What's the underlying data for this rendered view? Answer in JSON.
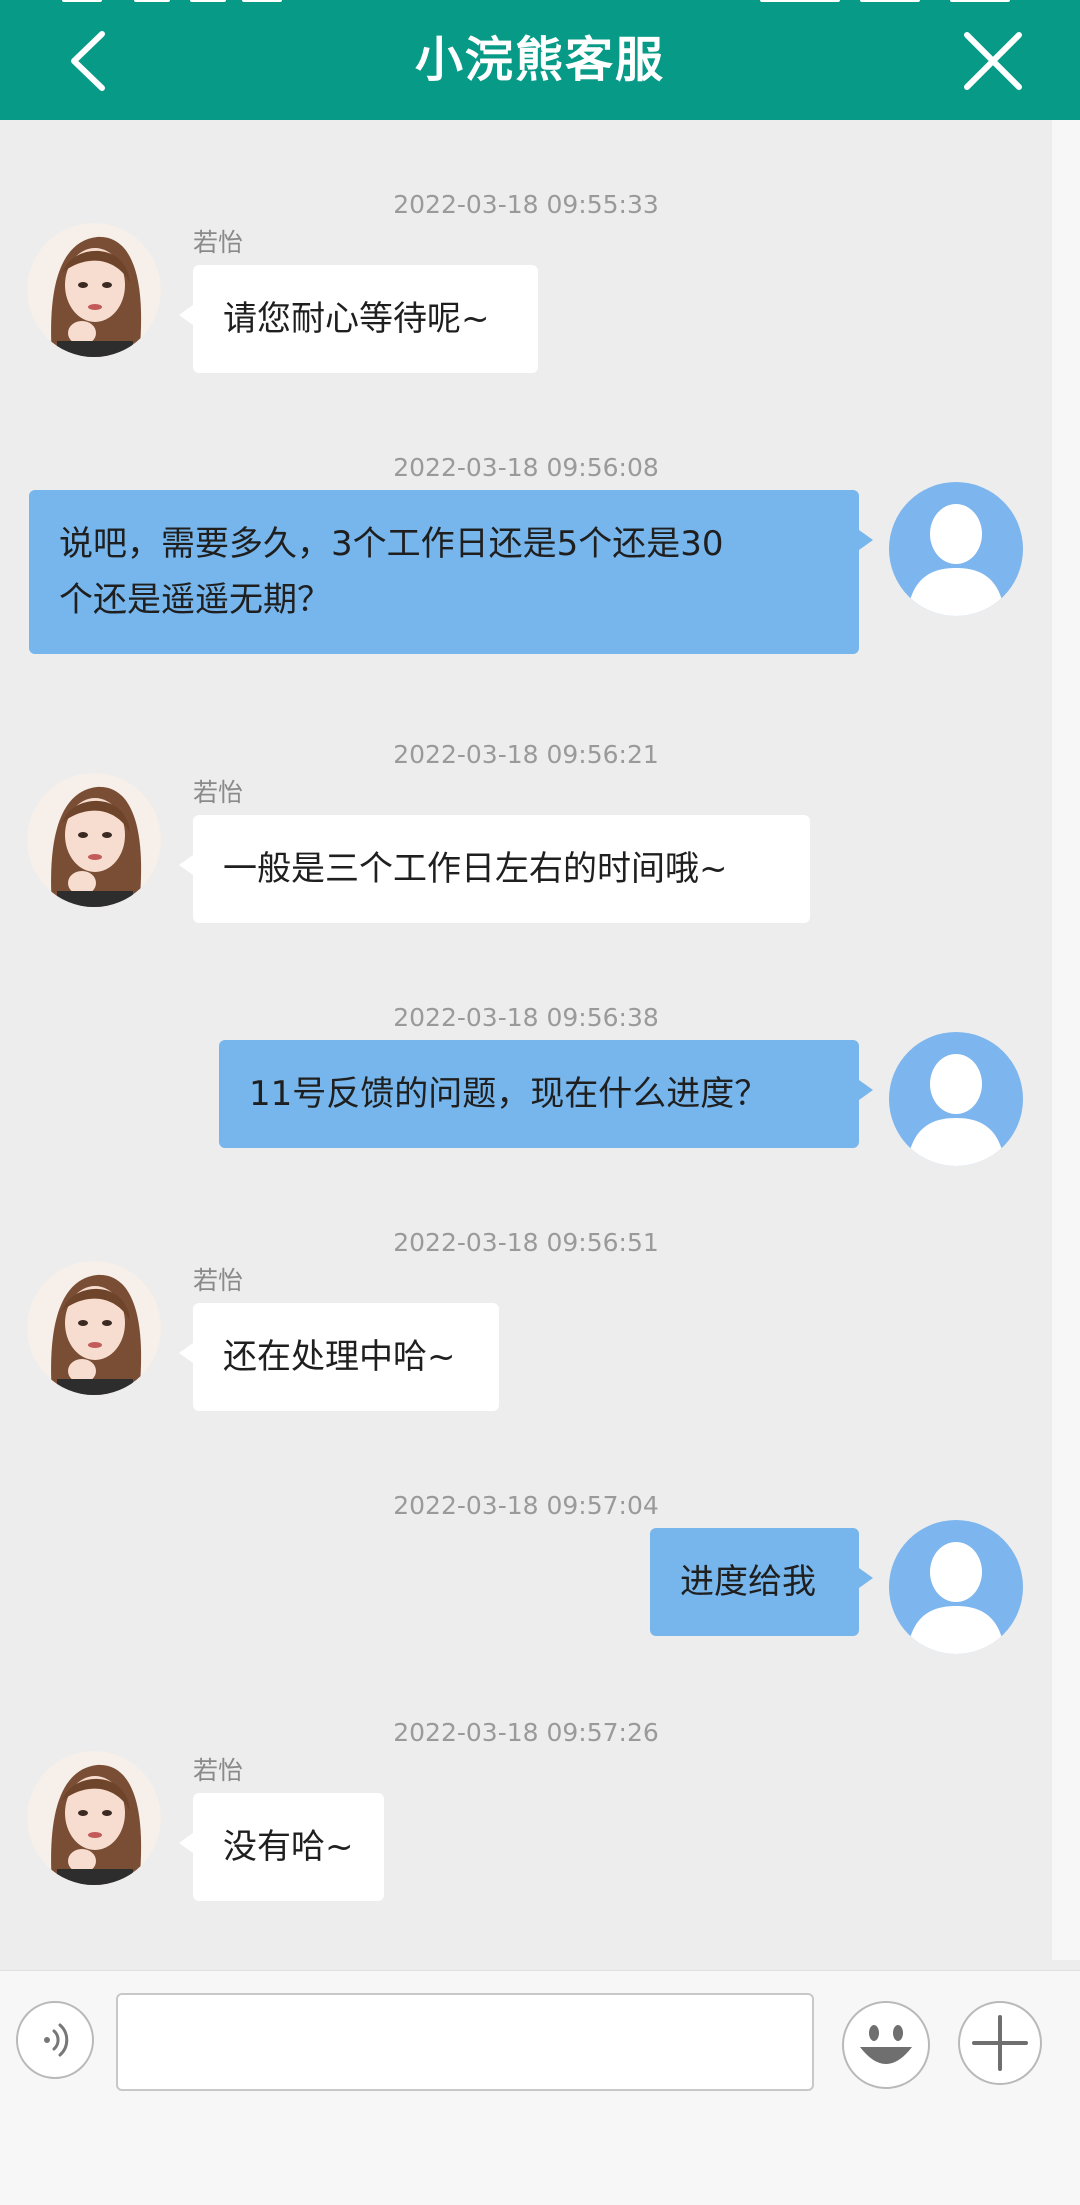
{
  "header": {
    "title": "小浣熊客服"
  },
  "messages": [
    {
      "time": "2022-03-18 09:55:33",
      "side": "in",
      "sender": "若怡",
      "lines": [
        "请您耐心等待呢~"
      ]
    },
    {
      "time": "2022-03-18 09:56:08",
      "side": "out",
      "lines": [
        "说吧，需要多久，3个工作日还是5个还是30",
        "个还是遥遥无期？"
      ]
    },
    {
      "time": "2022-03-18 09:56:21",
      "side": "in",
      "sender": "若怡",
      "lines": [
        "一般是三个工作日左右的时间哦~"
      ]
    },
    {
      "time": "2022-03-18 09:56:38",
      "side": "out",
      "lines": [
        "11号反馈的问题，现在什么进度？"
      ]
    },
    {
      "time": "2022-03-18 09:56:51",
      "side": "in",
      "sender": "若怡",
      "lines": [
        "还在处理中哈~"
      ]
    },
    {
      "time": "2022-03-18 09:57:04",
      "side": "out",
      "lines": [
        "进度给我"
      ]
    },
    {
      "time": "2022-03-18 09:57:26",
      "side": "in",
      "sender": "若怡",
      "lines": [
        "没有哈~"
      ]
    }
  ],
  "input": {
    "value": "",
    "placeholder": ""
  },
  "icons": {
    "back": "chevron-left-icon",
    "close": "close-icon",
    "voice": "voice-icon",
    "emoji": "emoji-icon",
    "plus": "plus-icon",
    "agent_avatar": "agent-avatar",
    "user_avatar": "user-avatar-placeholder"
  },
  "colors": {
    "header": "#069a87",
    "background": "#ededed",
    "outgoing_bubble": "#77b6ec",
    "incoming_bubble": "#ffffff",
    "timestamp": "#9a9a9a"
  }
}
